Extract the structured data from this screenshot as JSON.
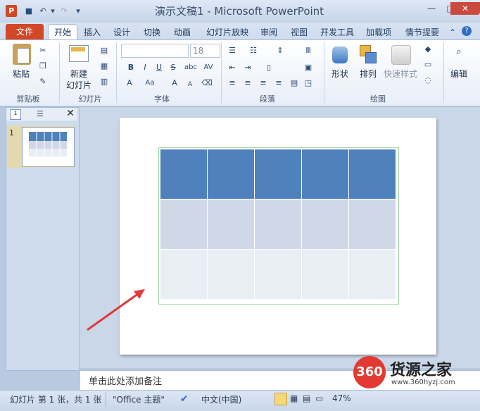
{
  "window": {
    "title": "演示文稿1 - Microsoft PowerPoint",
    "app_icon": "P",
    "controls": {
      "minimize": "—",
      "maximize": "□",
      "close": "✕"
    }
  },
  "tabs": [
    "文件",
    "开始",
    "插入",
    "设计",
    "切换",
    "动画",
    "幻灯片放映",
    "审阅",
    "视图",
    "开发工具",
    "加载项",
    "情节提要"
  ],
  "ribbon": {
    "clipboard": {
      "paste_label": "粘贴",
      "group_label": "剪贴板"
    },
    "slides": {
      "new_slide_label": "新建",
      "new_slide_label2": "幻灯片",
      "group_label": "幻灯片"
    },
    "font": {
      "font_name": "",
      "font_size": "18",
      "group_label": "字体",
      "bold": "B",
      "italic": "I",
      "underline": "U",
      "strike": "S",
      "shadow": "abc",
      "spacing": "AV",
      "grow": "A",
      "shrink": "A",
      "clear": "A",
      "case": "Aa"
    },
    "paragraph": {
      "group_label": "段落"
    },
    "drawing": {
      "shapes_label": "形状",
      "arrange_label": "排列",
      "quickstyles_label": "快速样式",
      "group_label": "绘图"
    },
    "editing": {
      "label": "编辑"
    }
  },
  "slides_pane": {
    "slide_number": "1"
  },
  "notes": {
    "placeholder": "单击此处添加备注"
  },
  "status": {
    "slide_info": "幻灯片 第 1 张，共 1 张",
    "theme": "\"Office 主题\"",
    "language": "中文(中国)",
    "zoom": "47%"
  },
  "watermark": {
    "badge": "360",
    "name": "货源之家",
    "url": "www.360hyzj.com"
  },
  "colors": {
    "header_cell": "#4f81bd",
    "band1_cell": "#d0d8e8",
    "band2_cell": "#e9edf4",
    "file_tab": "#d24726",
    "arrow": "#e03a3a"
  }
}
